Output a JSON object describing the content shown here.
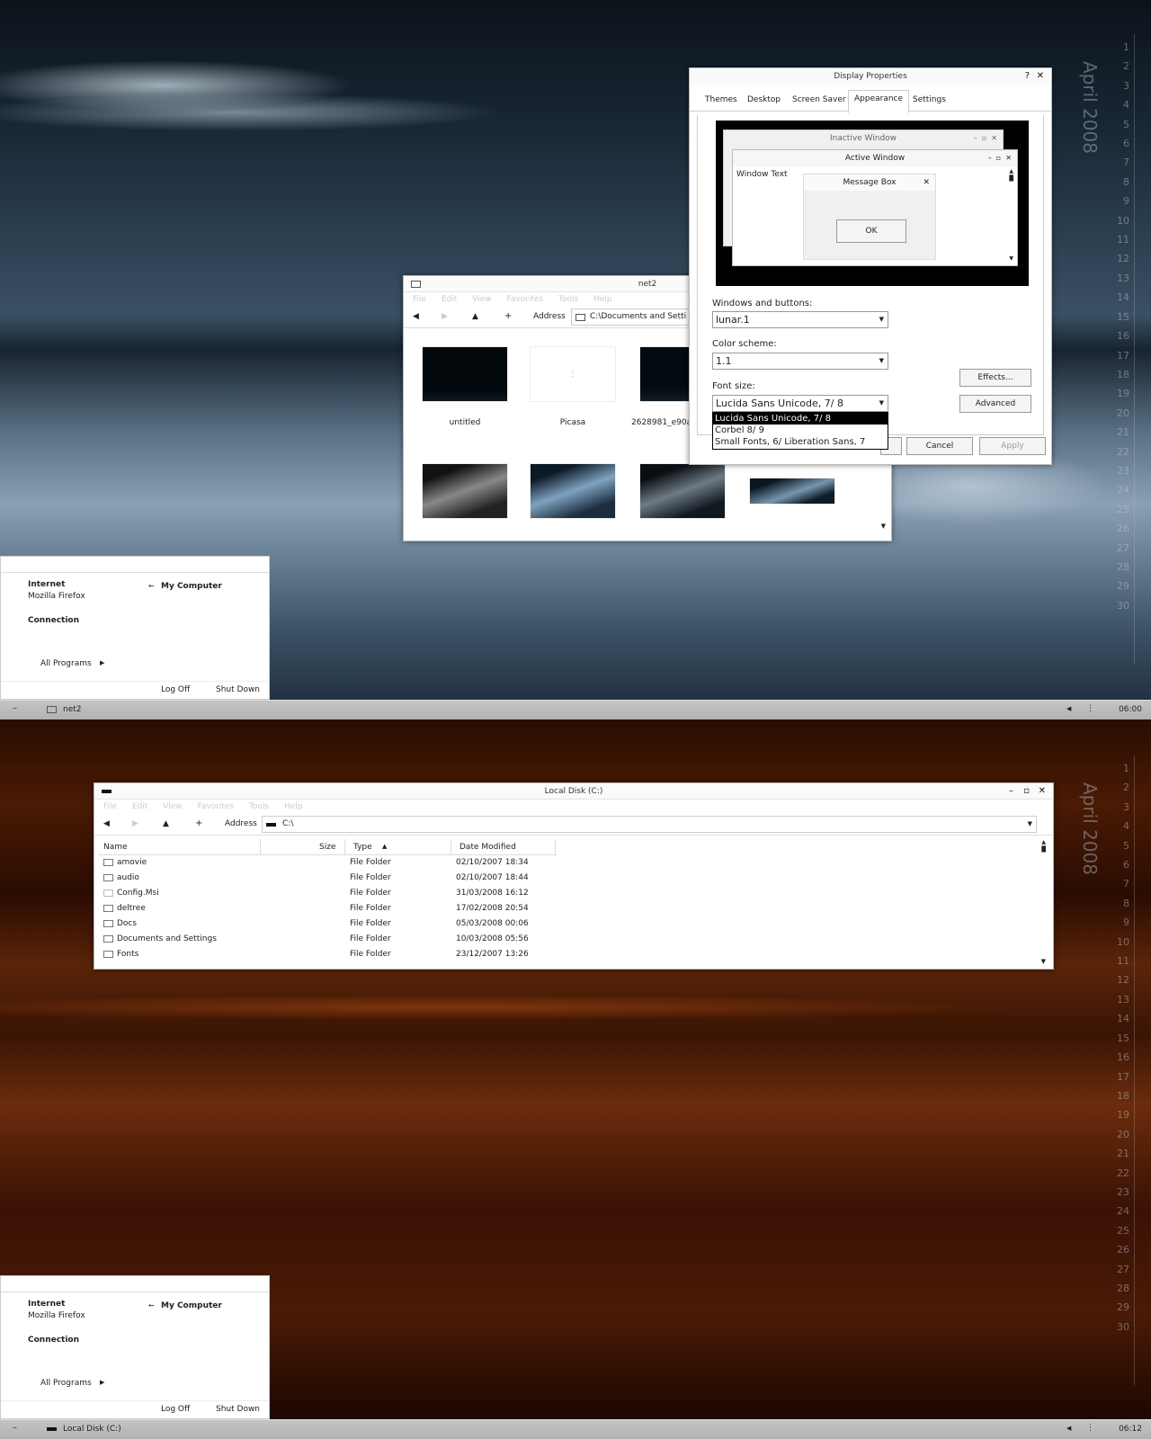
{
  "calendar": {
    "month": "April 2008",
    "days": [
      "1",
      "2",
      "3",
      "4",
      "5",
      "6",
      "7",
      "8",
      "9",
      "10",
      "11",
      "12",
      "13",
      "14",
      "15",
      "16",
      "17",
      "18",
      "19",
      "20",
      "21",
      "22",
      "23",
      "24",
      "25",
      "26",
      "27",
      "28",
      "29",
      "30"
    ]
  },
  "net2": {
    "title": "net2",
    "menu": [
      "File",
      "Edit",
      "View",
      "Favorites",
      "Tools",
      "Help"
    ],
    "address_label": "Address",
    "address": "C:\\Documents and Setti",
    "items": [
      "untitled",
      "Picasa",
      "2628981_e90a"
    ]
  },
  "display": {
    "title": "Display Properties",
    "help": "?",
    "tabs": [
      "Themes",
      "Desktop",
      "Screen Saver",
      "Appearance",
      "Settings"
    ],
    "preview": {
      "inactive": "Inactive Window",
      "active": "Active Window",
      "window_text": "Window Text",
      "message_box": "Message Box",
      "ok": "OK"
    },
    "windows_label": "Windows and buttons:",
    "windows_value": "lunar.1",
    "scheme_label": "Color scheme:",
    "scheme_value": "1.1",
    "font_label": "Font size:",
    "font_value": "Lucida Sans Unicode, 7/ 8",
    "font_options": [
      "Lucida Sans Unicode, 7/ 8",
      "Corbel 8/ 9",
      "Small Fonts, 6/ Liberation Sans, 7"
    ],
    "effects": "Effects...",
    "advanced": "Advanced",
    "cancel": "Cancel",
    "apply": "Apply"
  },
  "startmenu": {
    "internet": "Internet",
    "firefox": "Mozilla Firefox",
    "connection": "Connection",
    "my_computer": "My Computer",
    "all_programs": "All Programs",
    "log_off": "Log Off",
    "shut_down": "Shut Down"
  },
  "taskbar_top": {
    "item": "net2",
    "clock": "06:00"
  },
  "local": {
    "title": "Local Disk (C:)",
    "menu": [
      "File",
      "Edit",
      "View",
      "Favorites",
      "Tools",
      "Help"
    ],
    "address_label": "Address",
    "address": "C:\\",
    "columns": [
      "Name",
      "Size",
      "Type",
      "Date Modified"
    ],
    "rows": [
      {
        "name": "amovie",
        "type": "File Folder",
        "date": "02/10/2007 18:34"
      },
      {
        "name": "audio",
        "type": "File Folder",
        "date": "02/10/2007 18:44"
      },
      {
        "name": "Config.Msi",
        "type": "File Folder",
        "date": "31/03/2008 16:12"
      },
      {
        "name": "deltree",
        "type": "File Folder",
        "date": "17/02/2008 20:54"
      },
      {
        "name": "Docs",
        "type": "File Folder",
        "date": "05/03/2008 00:06"
      },
      {
        "name": "Documents and Settings",
        "type": "File Folder",
        "date": "10/03/2008 05:56"
      },
      {
        "name": "Fonts",
        "type": "File Folder",
        "date": "23/12/2007 13:26"
      }
    ]
  },
  "taskbar_bottom": {
    "item": "Local Disk (C:)",
    "clock": "06:12"
  }
}
